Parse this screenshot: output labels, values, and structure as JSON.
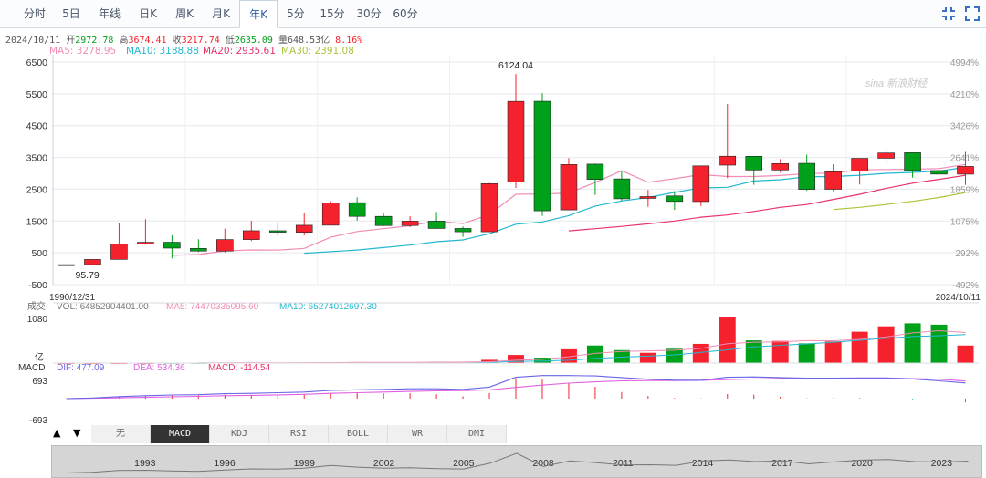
{
  "tabs": [
    {
      "label": "分时",
      "active": false
    },
    {
      "label": "5日",
      "active": false
    },
    {
      "label": "年线",
      "active": false
    },
    {
      "label": "日K",
      "active": false
    },
    {
      "label": "周K",
      "active": false
    },
    {
      "label": "月K",
      "active": false
    },
    {
      "label": "年K",
      "active": true
    },
    {
      "label": "5分",
      "active": false
    },
    {
      "label": "15分",
      "active": false
    },
    {
      "label": "30分",
      "active": false
    },
    {
      "label": "60分",
      "active": false
    }
  ],
  "toolbar": {
    "fit_icon": "fit-screen-icon",
    "expand_icon": "expand-icon"
  },
  "info": {
    "date": "2024/10/11",
    "open_label": "开",
    "open": "2972.78",
    "high_label": "高",
    "high": "3674.41",
    "close_label": "收",
    "close": "3217.74",
    "low_label": "低",
    "low": "2635.09",
    "vol_label": "量",
    "vol": "648.53亿",
    "change": "8.16%"
  },
  "ma": {
    "ma5": "MA5: 3278.95",
    "ma10": "MA10: 3188.88",
    "ma20": "MA20: 2935.61",
    "ma30": "MA30: 2391.08"
  },
  "volume_header": {
    "label": "成交",
    "vol": "VOL: 64852904401.00",
    "ma5": "MA5: 74470335095.60",
    "ma10": "MA10: 65274012697.30",
    "unit": "亿"
  },
  "macd_header": {
    "label": "MACD",
    "dif": "DIF: 477.09",
    "dea": "DEA: 534.36",
    "macd": "MACD: -114.54"
  },
  "watermark": "sina 新浪财经",
  "indicator_buttons": [
    {
      "label": "无",
      "active": false
    },
    {
      "label": "MACD",
      "active": true
    },
    {
      "label": "KDJ",
      "active": false
    },
    {
      "label": "RSI",
      "active": false
    },
    {
      "label": "BOLL",
      "active": false
    },
    {
      "label": "WR",
      "active": false
    },
    {
      "label": "DMI",
      "active": false
    }
  ],
  "nav_arrows": {
    "up": "▲",
    "down": "▼"
  },
  "colors": {
    "up": "#f5222d",
    "down": "#00a11a",
    "ma5": "#f08cb4",
    "ma10": "#24b8d0",
    "ma20": "#e8336a",
    "ma30": "#a8c43a",
    "dif": "#6a64e6",
    "dea": "#e060e0"
  },
  "chart_data": {
    "type": "candlestick",
    "x_start_label": "1990/12/31",
    "x_end_label": "2024/10/11",
    "price_axis": {
      "ticks": [
        6500,
        5500,
        4500,
        3500,
        2500,
        1500,
        500,
        -500
      ],
      "tick_labels": [
        "6500",
        "5500",
        "4500",
        "3500",
        "2500",
        "1500",
        "500",
        "-500"
      ],
      "ylim": [
        -500,
        6500
      ]
    },
    "percent_axis": {
      "ticks": [
        4994,
        4210,
        3426,
        2642,
        1859,
        1075,
        292,
        -492
      ],
      "tick_labels": [
        "4994%",
        "4210%",
        "3426%",
        "2641%",
        "1859%",
        "1075%",
        "292%",
        "-492%"
      ]
    },
    "annotations": [
      {
        "text": "6124.04",
        "year": 2007,
        "price": 6124.04
      },
      {
        "text": "95.79",
        "year": 1990,
        "price": 95.79
      }
    ],
    "candles": [
      {
        "year": 1990,
        "open": 96,
        "close": 128,
        "high": 128,
        "low": 96
      },
      {
        "year": 1991,
        "open": 128,
        "close": 292,
        "high": 292,
        "low": 105
      },
      {
        "year": 1992,
        "open": 293,
        "close": 780,
        "high": 1429,
        "low": 293
      },
      {
        "year": 1993,
        "open": 780,
        "close": 833,
        "high": 1558,
        "low": 750
      },
      {
        "year": 1994,
        "open": 833,
        "close": 648,
        "high": 1052,
        "low": 325
      },
      {
        "year": 1995,
        "open": 638,
        "close": 555,
        "high": 926,
        "low": 525
      },
      {
        "year": 1996,
        "open": 555,
        "close": 917,
        "high": 1258,
        "low": 512
      },
      {
        "year": 1997,
        "open": 917,
        "close": 1194,
        "high": 1510,
        "low": 870
      },
      {
        "year": 1998,
        "open": 1194,
        "close": 1147,
        "high": 1422,
        "low": 1043
      },
      {
        "year": 1999,
        "open": 1144,
        "close": 1367,
        "high": 1756,
        "low": 1047
      },
      {
        "year": 2000,
        "open": 1368,
        "close": 2073,
        "high": 2125,
        "low": 1361
      },
      {
        "year": 2001,
        "open": 2077,
        "close": 1646,
        "high": 2245,
        "low": 1514
      },
      {
        "year": 2002,
        "open": 1646,
        "close": 1358,
        "high": 1748,
        "low": 1339
      },
      {
        "year": 2003,
        "open": 1358,
        "close": 1497,
        "high": 1649,
        "low": 1307
      },
      {
        "year": 2004,
        "open": 1497,
        "close": 1266,
        "high": 1783,
        "low": 1259
      },
      {
        "year": 2005,
        "open": 1266,
        "close": 1161,
        "high": 1328,
        "low": 998
      },
      {
        "year": 2006,
        "open": 1161,
        "close": 2675,
        "high": 2698,
        "low": 1161
      },
      {
        "year": 2007,
        "open": 2728,
        "close": 5262,
        "high": 6124,
        "low": 2541
      },
      {
        "year": 2008,
        "open": 5265,
        "close": 1821,
        "high": 5522,
        "low": 1664
      },
      {
        "year": 2009,
        "open": 1849,
        "close": 3277,
        "high": 3478,
        "low": 1844
      },
      {
        "year": 2010,
        "open": 3289,
        "close": 2808,
        "high": 3306,
        "low": 2319
      },
      {
        "year": 2011,
        "open": 2825,
        "close": 2199,
        "high": 3067,
        "low": 2134
      },
      {
        "year": 2012,
        "open": 2212,
        "close": 2269,
        "high": 2478,
        "low": 1949
      },
      {
        "year": 2013,
        "open": 2289,
        "close": 2116,
        "high": 2444,
        "low": 1849
      },
      {
        "year": 2014,
        "open": 2112,
        "close": 3235,
        "high": 3239,
        "low": 1974
      },
      {
        "year": 2015,
        "open": 3258,
        "close": 3539,
        "high": 5178,
        "low": 2850
      },
      {
        "year": 2016,
        "open": 3536,
        "close": 3104,
        "high": 3538,
        "low": 2638
      },
      {
        "year": 2017,
        "open": 3105,
        "close": 3307,
        "high": 3450,
        "low": 3017
      },
      {
        "year": 2018,
        "open": 3314,
        "close": 2494,
        "high": 3587,
        "low": 2449
      },
      {
        "year": 2019,
        "open": 2497,
        "close": 3050,
        "high": 3288,
        "low": 2440
      },
      {
        "year": 2020,
        "open": 3066,
        "close": 3473,
        "high": 3474,
        "low": 2647
      },
      {
        "year": 2021,
        "open": 3474,
        "close": 3640,
        "high": 3732,
        "low": 3312
      },
      {
        "year": 2022,
        "open": 3649,
        "close": 3089,
        "high": 3652,
        "low": 2863
      },
      {
        "year": 2023,
        "open": 3088,
        "close": 2975,
        "high": 3419,
        "low": 2882
      },
      {
        "year": 2024,
        "open": 2973,
        "close": 3218,
        "high": 3674,
        "low": 2635
      }
    ],
    "ma5_series": [
      null,
      null,
      null,
      null,
      420,
      447,
      558,
      589,
      584,
      639,
      990,
      1170,
      1260,
      1350,
      1500,
      1420,
      1700,
      2340,
      2350,
      2380,
      2710,
      3080,
      2720,
      2830,
      2960,
      2900,
      2900,
      2930,
      2990,
      3010,
      3110,
      3120,
      3130,
      3150,
      3279
    ],
    "ma10_series": [
      null,
      null,
      null,
      null,
      null,
      null,
      null,
      null,
      null,
      486,
      536,
      587,
      665,
      742,
      847,
      907,
      1100,
      1400,
      1470,
      1670,
      1970,
      2130,
      2240,
      2400,
      2540,
      2560,
      2760,
      2800,
      2890,
      2900,
      2940,
      3000,
      3030,
      3070,
      3189
    ],
    "ma20_series": [
      null,
      null,
      null,
      null,
      null,
      null,
      null,
      null,
      null,
      null,
      null,
      null,
      null,
      null,
      null,
      null,
      null,
      null,
      null,
      1190,
      1260,
      1330,
      1410,
      1500,
      1620,
      1690,
      1800,
      1930,
      2020,
      2180,
      2340,
      2530,
      2690,
      2810,
      2936
    ],
    "ma30_series": [
      null,
      null,
      null,
      null,
      null,
      null,
      null,
      null,
      null,
      null,
      null,
      null,
      null,
      null,
      null,
      null,
      null,
      null,
      null,
      null,
      null,
      null,
      null,
      null,
      null,
      null,
      null,
      null,
      null,
      1860,
      1930,
      2020,
      2120,
      2240,
      2391
    ],
    "volume": {
      "ylabel_max": "1080",
      "unit": "亿",
      "values": [
        0,
        0,
        0,
        0,
        5,
        5,
        15,
        20,
        10,
        15,
        30,
        35,
        25,
        30,
        40,
        35,
        120,
        300,
        200,
        510,
        650,
        480,
        380,
        530,
        710,
        1720,
        840,
        820,
        730,
        800,
        1160,
        1360,
        1470,
        1420,
        649
      ],
      "ma5": [
        null,
        null,
        null,
        null,
        null,
        6,
        10,
        13,
        11,
        12,
        18,
        23,
        23,
        27,
        32,
        33,
        50,
        105,
        139,
        233,
        356,
        428,
        452,
        474,
        544,
        718,
        772,
        786,
        830,
        826,
        878,
        966,
        1116,
        1198,
        1129
      ],
      "ma10": [
        null,
        null,
        null,
        null,
        null,
        null,
        null,
        null,
        null,
        null,
        12,
        14,
        16,
        18,
        21,
        24,
        32,
        60,
        76,
        106,
        171,
        218,
        257,
        304,
        393,
        490,
        599,
        656,
        708,
        773,
        843,
        917,
        981,
        1012,
        1055
      ]
    },
    "macd": {
      "label_top": "693",
      "label_bottom": "-693",
      "ylim": [
        -693,
        693
      ],
      "dif": [
        0,
        20,
        60,
        90,
        110,
        120,
        150,
        160,
        180,
        200,
        250,
        270,
        280,
        300,
        300,
        280,
        350,
        650,
        700,
        700,
        690,
        640,
        590,
        560,
        560,
        650,
        660,
        640,
        620,
        620,
        630,
        630,
        600,
        540,
        477
      ],
      "dea": [
        0,
        10,
        25,
        40,
        55,
        70,
        90,
        100,
        115,
        130,
        160,
        180,
        200,
        220,
        235,
        245,
        265,
        340,
        410,
        470,
        510,
        540,
        550,
        550,
        555,
        580,
        600,
        610,
        615,
        615,
        620,
        620,
        610,
        590,
        534
      ],
      "hist": [
        0,
        20,
        70,
        100,
        110,
        100,
        120,
        120,
        130,
        140,
        180,
        180,
        160,
        160,
        130,
        70,
        170,
        620,
        580,
        460,
        360,
        200,
        80,
        20,
        10,
        140,
        120,
        60,
        10,
        10,
        20,
        20,
        -20,
        -100,
        -115
      ]
    }
  }
}
